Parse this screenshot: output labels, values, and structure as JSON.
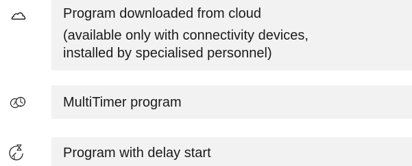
{
  "rows": [
    {
      "icon": "cloud-icon",
      "lines": [
        "Program downloaded from cloud",
        "(available only with connectivity devices,",
        "installed by specialised personnel)"
      ]
    },
    {
      "icon": "multitimer-icon",
      "lines": [
        "MultiTimer program"
      ]
    },
    {
      "icon": "delay-start-icon",
      "lines": [
        "Program with delay start"
      ]
    }
  ],
  "colors": {
    "row_background": "#f2f2f2",
    "text": "#1a1a1a",
    "icon": "#222222"
  }
}
